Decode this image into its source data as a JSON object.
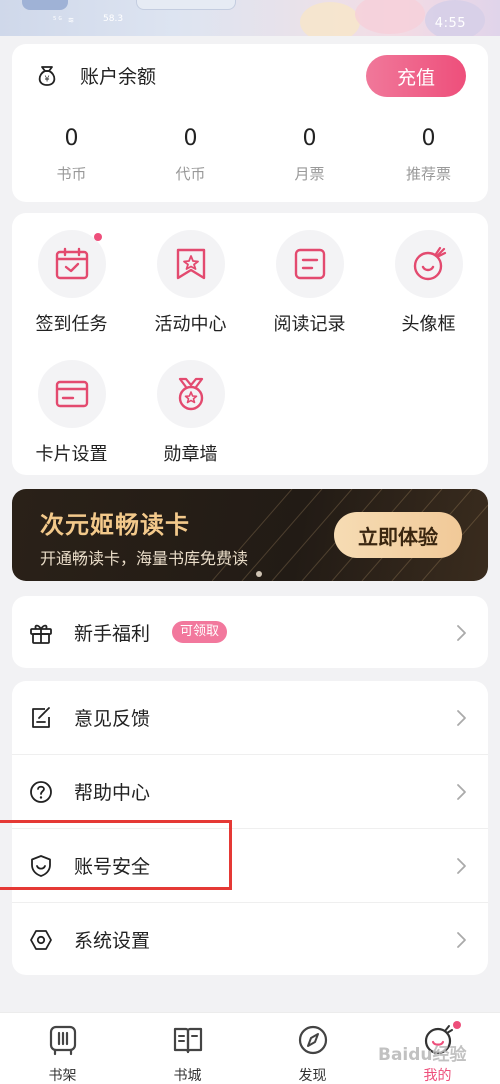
{
  "status_bar": {
    "left": "58.3",
    "time": "4:55"
  },
  "balance": {
    "title": "账户余额",
    "recharge_label": "充值",
    "stats": [
      {
        "value": "0",
        "label": "书币"
      },
      {
        "value": "0",
        "label": "代币"
      },
      {
        "value": "0",
        "label": "月票"
      },
      {
        "value": "0",
        "label": "推荐票"
      }
    ]
  },
  "functions": [
    {
      "label": "签到任务",
      "icon": "calendar-check-icon",
      "dot": true
    },
    {
      "label": "活动中心",
      "icon": "bookmark-star-icon",
      "dot": false
    },
    {
      "label": "阅读记录",
      "icon": "reading-record-icon",
      "dot": false
    },
    {
      "label": "头像框",
      "icon": "avatar-frame-icon",
      "dot": false
    },
    {
      "label": "卡片设置",
      "icon": "card-icon",
      "dot": false
    },
    {
      "label": "勋章墙",
      "icon": "medal-icon",
      "dot": false
    }
  ],
  "promo": {
    "title": "次元姬畅读卡",
    "subtitle": "开通畅读卡，海量书库免费读",
    "button": "立即体验"
  },
  "list_1": [
    {
      "label": "新手福利",
      "badge": "可领取",
      "icon": "gift-icon"
    }
  ],
  "list_2": [
    {
      "label": "意见反馈",
      "icon": "feedback-icon"
    },
    {
      "label": "帮助中心",
      "icon": "help-icon"
    },
    {
      "label": "账号安全",
      "icon": "shield-icon"
    },
    {
      "label": "系统设置",
      "icon": "settings-icon"
    }
  ],
  "nav": [
    {
      "label": "书架",
      "icon": "bookshelf-icon",
      "active": false
    },
    {
      "label": "书城",
      "icon": "bookstore-icon",
      "active": false
    },
    {
      "label": "发现",
      "icon": "compass-icon",
      "active": false
    },
    {
      "label": "我的",
      "icon": "profile-icon",
      "active": true
    }
  ],
  "colors": {
    "accent": "#ee4f7b",
    "promo_gold": "#f3c98b",
    "highlight": "#e53935"
  },
  "watermark": "Baidu经验"
}
